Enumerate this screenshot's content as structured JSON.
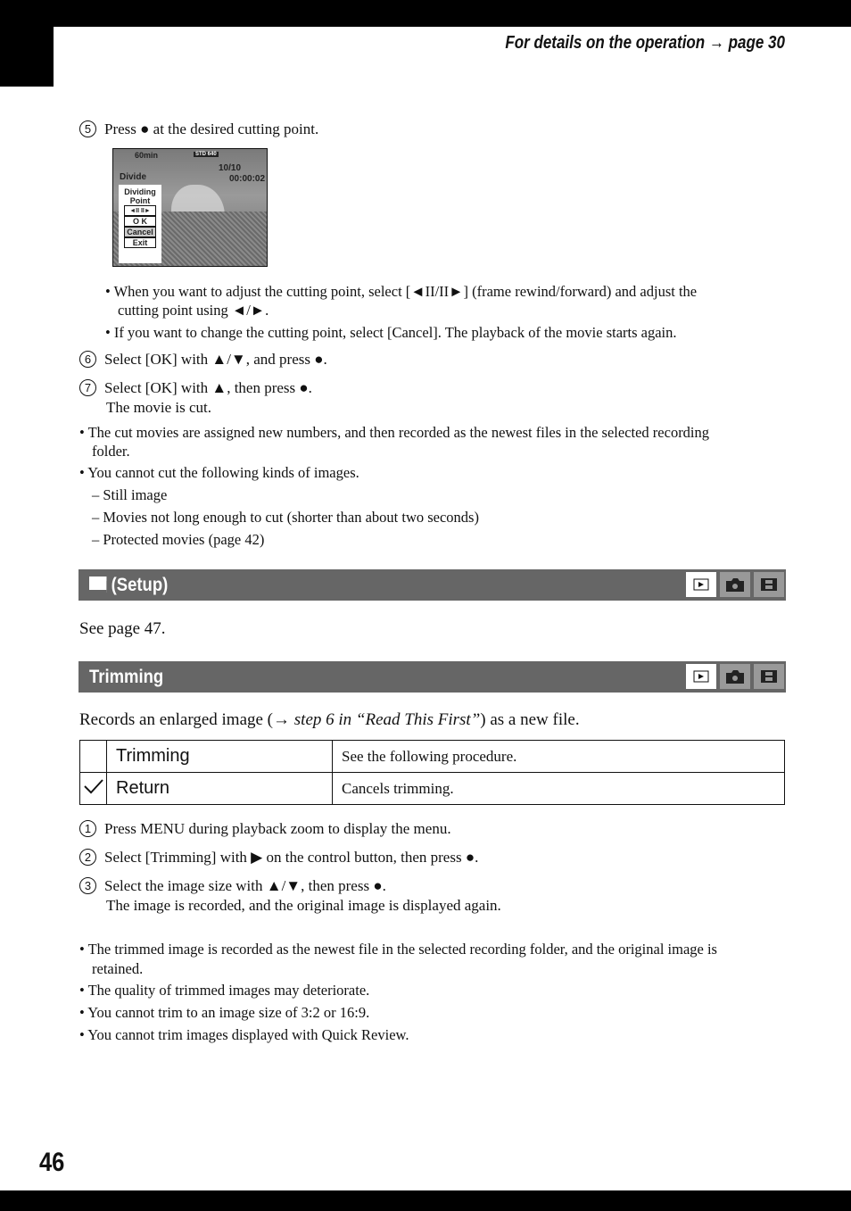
{
  "header": {
    "text": "For details on the operation → page 30"
  },
  "page_number": "46",
  "step5": {
    "num": "5",
    "text": "Press ● at the desired cutting point."
  },
  "lcd": {
    "battery": "60min",
    "quality": "STD 640",
    "count": "10/10",
    "mode": "Divide",
    "time": "00:00:02",
    "menu_title": "Dividing Point",
    "frame_btn": "◄II II►",
    "ok": "O K",
    "cancel": "Cancel",
    "exit": "Exit"
  },
  "step5_bullets": [
    "• When you want to adjust the cutting point, select [◄II/II►] (frame rewind/forward) and adjust the",
    "cutting point using ◄/►.",
    "• If you want to change the cutting point, select [Cancel]. The playback of the movie starts again."
  ],
  "step6": {
    "num": "6",
    "text": "Select [OK] with ▲/▼, and press ●."
  },
  "step7": {
    "num": "7",
    "text": "Select [OK] with ▲, then press ●.",
    "sub": "The movie is cut."
  },
  "notes1": [
    "• The cut movies are assigned new numbers, and then recorded as the newest files in the selected recording",
    "folder.",
    "• You cannot cut the following kinds of images.",
    "–  Still image",
    "–  Movies not long enough to cut (shorter than about two seconds)",
    "–  Protected movies (page 42)"
  ],
  "setup": {
    "title": "(Setup)",
    "see": "See page 47."
  },
  "trimming": {
    "title": "Trimming",
    "intro_a": "Records an enlarged image (→ ",
    "intro_b": "step 6 in “Read This First”",
    "intro_c": ") as a new file.",
    "table": [
      {
        "mark": "",
        "name": "Trimming",
        "desc": "See the following procedure."
      },
      {
        "mark": "check",
        "name": "Return",
        "desc": "Cancels trimming."
      }
    ],
    "steps": [
      {
        "num": "1",
        "text": "Press MENU during playback zoom to display the menu."
      },
      {
        "num": "2",
        "text": "Select [Trimming] with ▶ on the control button, then press ●."
      },
      {
        "num": "3",
        "text": "Select the image size with ▲/▼, then press ●.",
        "sub": "The image is recorded, and the original image is displayed again."
      }
    ],
    "notes": [
      "• The trimmed image is recorded as the newest file in the selected recording folder, and the original image is",
      "retained.",
      "• The quality of trimmed images may deteriorate.",
      "• You cannot trim to an image size of 3:2 or 16:9.",
      "• You cannot trim images displayed with Quick Review."
    ]
  },
  "mode_icons": [
    "playback-icon",
    "still-camera-icon",
    "movie-icon"
  ],
  "colors": {
    "bar": "#666666",
    "icon_bg": "#999999"
  }
}
